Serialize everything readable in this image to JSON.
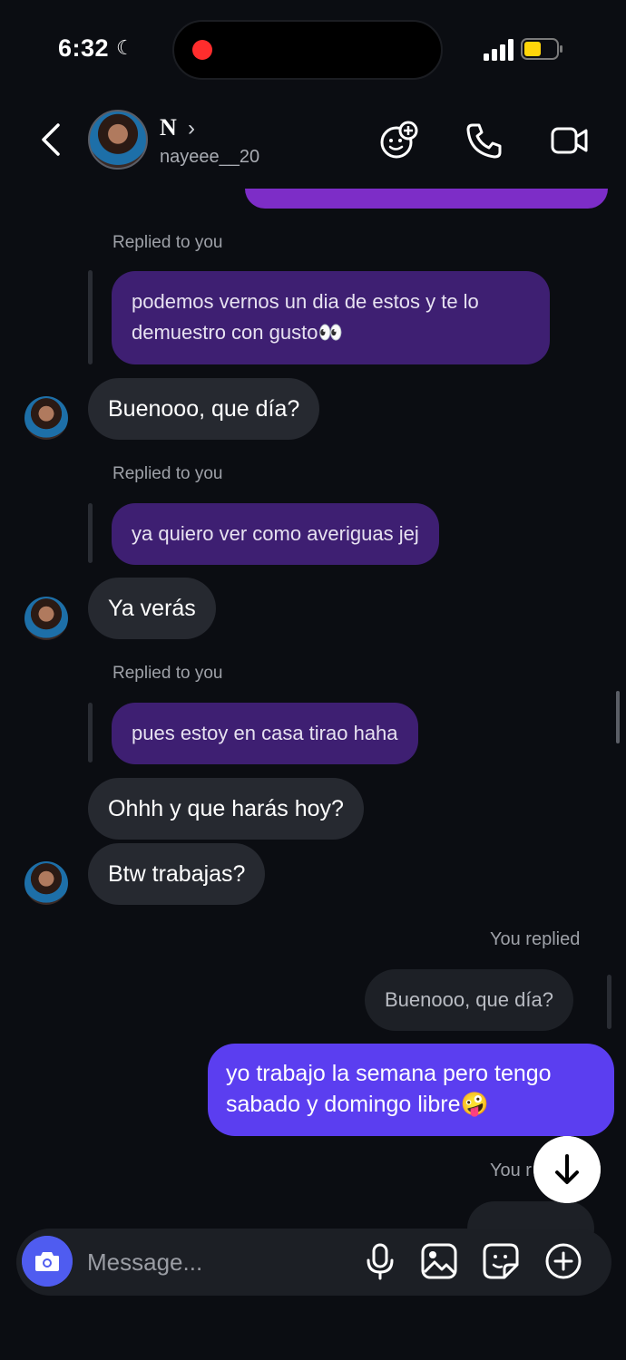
{
  "status_bar": {
    "time": "6:32"
  },
  "header": {
    "display_name": "N",
    "username": "nayeee__20"
  },
  "messages": [
    {
      "label": "Replied to you",
      "quoted": "podemos vernos un dia de estos y te lo demuestro con gusto👀",
      "reply": "Buenooo, que día?"
    },
    {
      "label": "Replied to you",
      "quoted": "ya quiero ver como averiguas jej",
      "reply": "Ya verás"
    },
    {
      "label": "Replied to you",
      "quoted": "pues estoy en casa tirao haha",
      "reply": "Ohhh y que harás hoy?"
    }
  ],
  "extra_incoming": "Btw trabajas?",
  "outgoing": {
    "label": "You replied",
    "quoted": "Buenooo, que día?",
    "text": "yo trabajo la semana pero tengo sabado y domingo libre🤪",
    "next_label": "You r"
  },
  "composer": {
    "placeholder": "Message..."
  },
  "colors": {
    "outgoing_bubble": "#5b3ef0",
    "quoted_bubble": "#3e1f72",
    "incoming_bubble": "#262930",
    "camera_button": "#4f5cf0"
  }
}
